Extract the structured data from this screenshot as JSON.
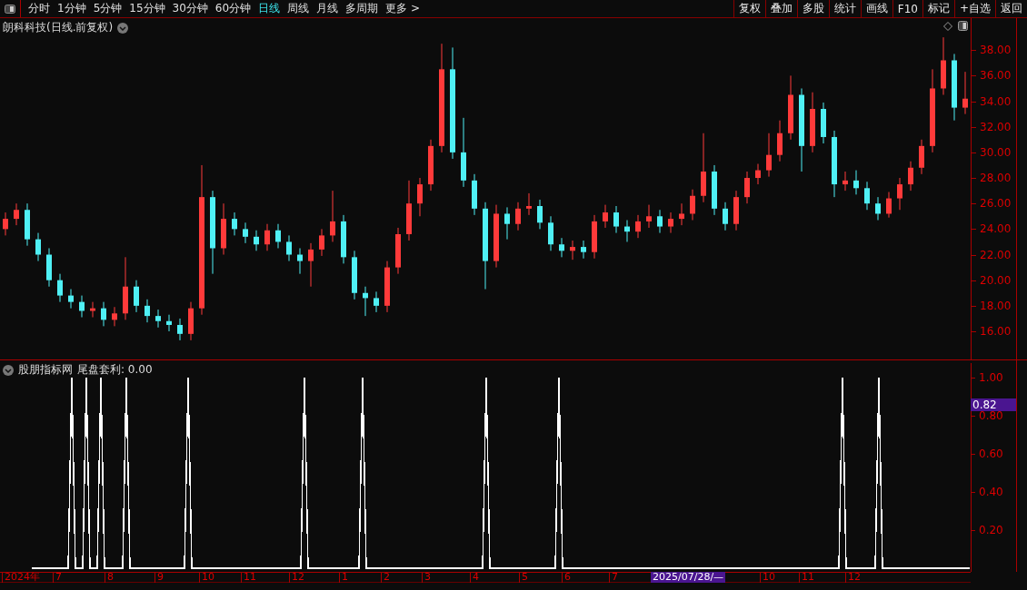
{
  "toolbar": {
    "periods": [
      {
        "label": "分时",
        "selected": false
      },
      {
        "label": "1分钟",
        "selected": false
      },
      {
        "label": "5分钟",
        "selected": false
      },
      {
        "label": "15分钟",
        "selected": false
      },
      {
        "label": "30分钟",
        "selected": false
      },
      {
        "label": "60分钟",
        "selected": false
      },
      {
        "label": "日线",
        "selected": true
      },
      {
        "label": "周线",
        "selected": false
      },
      {
        "label": "月线",
        "selected": false
      },
      {
        "label": "多周期",
        "selected": false
      },
      {
        "label": "更多 >",
        "selected": false
      }
    ],
    "actions": [
      "复权",
      "叠加",
      "多股",
      "统计",
      "画线",
      "F10",
      "标记",
      "+自选",
      "返回"
    ]
  },
  "main_chart": {
    "title": "朗科科技(日线.前复权)",
    "chart_data": {
      "type": "candlestick",
      "ylim": [
        13.8,
        40.5
      ],
      "yticks": [
        {
          "value": 38,
          "label": "38.00"
        },
        {
          "value": 36,
          "label": "36.00"
        },
        {
          "value": 34,
          "label": "34.00"
        },
        {
          "value": 32,
          "label": "32.00"
        },
        {
          "value": 30,
          "label": "30.00"
        },
        {
          "value": 28,
          "label": "28.00"
        },
        {
          "value": 26,
          "label": "26.00"
        },
        {
          "value": 24,
          "label": "24.00"
        },
        {
          "value": 22,
          "label": "22.00"
        },
        {
          "value": 20,
          "label": "20.00"
        },
        {
          "value": 18,
          "label": "18.00"
        },
        {
          "value": 16,
          "label": "16.00"
        }
      ],
      "categories": [
        null,
        null,
        null,
        null,
        null,
        null,
        null,
        null,
        null,
        null,
        null,
        null,
        null,
        null,
        null,
        null,
        null,
        null,
        null,
        null,
        null,
        null,
        null,
        null,
        null,
        null,
        null,
        null,
        null,
        null,
        null,
        null,
        null,
        null,
        null,
        null,
        null,
        null,
        null,
        null,
        null,
        null,
        null,
        null,
        null,
        null,
        null,
        null,
        null,
        null,
        null,
        null,
        null,
        null,
        null,
        null,
        null,
        null,
        null,
        null,
        null,
        null,
        null,
        null,
        null,
        null,
        null,
        null,
        null,
        null,
        null,
        null,
        null,
        null,
        null,
        null,
        null,
        null,
        null,
        null,
        null,
        null,
        null,
        null,
        null,
        null,
        null,
        null,
        null
      ],
      "ohlc": [
        [
          24.0,
          25.3,
          23.5,
          24.8
        ],
        [
          24.8,
          26.0,
          24.3,
          25.5
        ],
        [
          25.5,
          26.0,
          22.7,
          23.2
        ],
        [
          23.2,
          23.7,
          21.5,
          22.0
        ],
        [
          22.0,
          22.5,
          19.5,
          20.0
        ],
        [
          20.0,
          20.5,
          18.3,
          18.8
        ],
        [
          18.8,
          19.3,
          17.8,
          18.3
        ],
        [
          18.3,
          18.8,
          17.1,
          17.6
        ],
        [
          17.6,
          18.3,
          17.1,
          17.8
        ],
        [
          17.8,
          18.3,
          16.4,
          16.9
        ],
        [
          16.9,
          17.9,
          16.4,
          17.4
        ],
        [
          17.4,
          21.8,
          16.9,
          19.5
        ],
        [
          19.5,
          20.0,
          17.5,
          18.0
        ],
        [
          18.0,
          18.5,
          16.7,
          17.2
        ],
        [
          17.2,
          17.7,
          16.3,
          16.8
        ],
        [
          16.8,
          17.3,
          16.0,
          16.5
        ],
        [
          16.5,
          17.0,
          15.3,
          15.8
        ],
        [
          15.8,
          18.3,
          15.3,
          17.8
        ],
        [
          17.8,
          29.0,
          17.3,
          26.5
        ],
        [
          26.5,
          27.0,
          20.5,
          22.5
        ],
        [
          22.5,
          26.0,
          22.0,
          24.8
        ],
        [
          24.8,
          25.3,
          23.5,
          24.0
        ],
        [
          24.0,
          24.5,
          22.9,
          23.4
        ],
        [
          23.4,
          23.9,
          22.3,
          22.8
        ],
        [
          22.8,
          24.4,
          22.3,
          23.9
        ],
        [
          23.9,
          24.4,
          22.5,
          23.0
        ],
        [
          23.0,
          23.5,
          21.5,
          22.0
        ],
        [
          22.0,
          22.5,
          20.5,
          21.5
        ],
        [
          21.5,
          22.9,
          19.5,
          22.4
        ],
        [
          22.4,
          24.0,
          21.9,
          23.5
        ],
        [
          23.5,
          27.0,
          23.0,
          24.6
        ],
        [
          24.6,
          25.1,
          21.3,
          21.8
        ],
        [
          21.8,
          22.3,
          18.5,
          19.0
        ],
        [
          19.0,
          19.5,
          17.2,
          18.6
        ],
        [
          18.6,
          19.1,
          17.5,
          18.0
        ],
        [
          18.0,
          21.5,
          17.5,
          21.0
        ],
        [
          21.0,
          24.1,
          20.5,
          23.6
        ],
        [
          23.6,
          27.8,
          23.1,
          26.0
        ],
        [
          26.0,
          28.0,
          25.0,
          27.5
        ],
        [
          27.5,
          31.0,
          27.0,
          30.5
        ],
        [
          30.5,
          38.5,
          30.0,
          36.5
        ],
        [
          36.5,
          38.2,
          29.5,
          30.0
        ],
        [
          30.0,
          32.7,
          27.3,
          27.8
        ],
        [
          27.8,
          28.3,
          25.1,
          25.6
        ],
        [
          25.6,
          26.1,
          19.3,
          21.5
        ],
        [
          21.5,
          25.9,
          21.0,
          25.2
        ],
        [
          25.2,
          25.7,
          23.2,
          24.4
        ],
        [
          24.4,
          26.1,
          23.9,
          25.6
        ],
        [
          25.6,
          26.8,
          25.1,
          25.8
        ],
        [
          25.8,
          26.3,
          24.0,
          24.5
        ],
        [
          24.5,
          25.0,
          22.3,
          22.8
        ],
        [
          22.8,
          23.3,
          21.8,
          22.3
        ],
        [
          22.3,
          23.1,
          21.6,
          22.6
        ],
        [
          22.6,
          23.1,
          21.7,
          22.2
        ],
        [
          22.2,
          25.1,
          21.7,
          24.6
        ],
        [
          24.6,
          25.9,
          24.1,
          25.3
        ],
        [
          25.3,
          25.8,
          23.7,
          24.2
        ],
        [
          24.2,
          24.7,
          23.0,
          23.8
        ],
        [
          23.8,
          25.1,
          23.3,
          24.6
        ],
        [
          24.6,
          25.9,
          24.1,
          25.0
        ],
        [
          25.0,
          25.5,
          23.7,
          24.2
        ],
        [
          24.2,
          25.3,
          23.7,
          24.8
        ],
        [
          24.8,
          26.0,
          24.3,
          25.2
        ],
        [
          25.2,
          27.1,
          24.7,
          26.6
        ],
        [
          26.6,
          31.5,
          26.1,
          28.5
        ],
        [
          28.5,
          29.0,
          25.1,
          25.6
        ],
        [
          25.6,
          26.1,
          23.9,
          24.4
        ],
        [
          24.4,
          27.0,
          23.9,
          26.5
        ],
        [
          26.5,
          28.5,
          26.0,
          28.0
        ],
        [
          28.0,
          29.1,
          27.5,
          28.6
        ],
        [
          28.6,
          31.5,
          28.1,
          29.8
        ],
        [
          29.8,
          32.5,
          29.3,
          31.5
        ],
        [
          31.5,
          36.0,
          31.0,
          34.5
        ],
        [
          34.5,
          35.0,
          28.5,
          30.5
        ],
        [
          30.5,
          34.7,
          30.0,
          33.4
        ],
        [
          33.4,
          33.9,
          30.7,
          31.2
        ],
        [
          31.2,
          31.7,
          26.5,
          27.5
        ],
        [
          27.5,
          28.5,
          27.0,
          27.8
        ],
        [
          27.8,
          28.6,
          26.7,
          27.2
        ],
        [
          27.2,
          27.7,
          25.5,
          26.0
        ],
        [
          26.0,
          26.5,
          24.7,
          25.2
        ],
        [
          25.2,
          26.9,
          24.9,
          26.4
        ],
        [
          26.4,
          28.0,
          25.5,
          27.5
        ],
        [
          27.5,
          29.3,
          27.0,
          28.8
        ],
        [
          28.8,
          31.0,
          28.3,
          30.5
        ],
        [
          30.5,
          36.5,
          30.0,
          35.0
        ],
        [
          35.0,
          39.0,
          34.5,
          37.2
        ],
        [
          37.2,
          37.7,
          32.5,
          33.5
        ],
        [
          33.5,
          36.3,
          33.0,
          34.2
        ]
      ]
    }
  },
  "indicator": {
    "source": "股朋指标网",
    "reading": ": 0.00",
    "cursor_value": "0.82",
    "chart_data": {
      "type": "line",
      "ylim": [
        -0.0167,
        1.079
      ],
      "yticks": [
        {
          "value": 0.2,
          "label": "0.20"
        },
        {
          "value": 0.4,
          "label": "0.40"
        },
        {
          "value": 0.6,
          "label": "0.60"
        },
        {
          "value": 0.8,
          "label": "0.80"
        },
        {
          "value": 1.0,
          "label": "1.00"
        }
      ],
      "categories": [
        null,
        null,
        null,
        null,
        null,
        null,
        null,
        null,
        null,
        null,
        null,
        null,
        null,
        null,
        null,
        null,
        null,
        null,
        null,
        null,
        null,
        null,
        null,
        null,
        null,
        null,
        null,
        null,
        null,
        null,
        null,
        null,
        null,
        null,
        null,
        null,
        null,
        null,
        null,
        null,
        null,
        null,
        null,
        null,
        null,
        null,
        null,
        null,
        null,
        null,
        null,
        null,
        null,
        null,
        null,
        null,
        null,
        null,
        null,
        null,
        null,
        null,
        null,
        null,
        null,
        null,
        null,
        null,
        null,
        null,
        null,
        null,
        null,
        null,
        null,
        null,
        null,
        null,
        null,
        null,
        null,
        null,
        null,
        null,
        null,
        null,
        null,
        null,
        null,
        null,
        null,
        null,
        null,
        null,
        null,
        null,
        null,
        null,
        null,
        null,
        null,
        null,
        null,
        null,
        null,
        null,
        null,
        null,
        null,
        null,
        null,
        null,
        null,
        null,
        null,
        null,
        null,
        null,
        null,
        null,
        null,
        null,
        null,
        null,
        null,
        null,
        null,
        null,
        null,
        null,
        null,
        null,
        null,
        null,
        null,
        null,
        null,
        null,
        null,
        null,
        null,
        null,
        null,
        null,
        null,
        null,
        null,
        null,
        null,
        null,
        null,
        null,
        null,
        null,
        null,
        null,
        null,
        null,
        null,
        null,
        null,
        null,
        null,
        null,
        null,
        null,
        null,
        null,
        null,
        null,
        null,
        null,
        null,
        null,
        null,
        null,
        null,
        null,
        null,
        null,
        null,
        null,
        null,
        null,
        null,
        null,
        null,
        null,
        null,
        null,
        null,
        null,
        null,
        null,
        null,
        null,
        null,
        null,
        null,
        null,
        null,
        null,
        null,
        null,
        null,
        null,
        null,
        null,
        null,
        null,
        null,
        null,
        null,
        null,
        null,
        null,
        null,
        null,
        null,
        null,
        null,
        null,
        null,
        null,
        null,
        null,
        null,
        null,
        null,
        null,
        null,
        null,
        null,
        null,
        null,
        null,
        null,
        null,
        null,
        null,
        null,
        null,
        null,
        null,
        null,
        null,
        null,
        null,
        null,
        null,
        null,
        null,
        null,
        null,
        null,
        null,
        null,
        null,
        null
      ],
      "series": [
        {
          "name": "尾盘套利",
          "color": "#ffffff",
          "values": [
            0,
            0,
            0,
            0,
            0,
            0,
            0,
            0,
            0,
            0,
            0,
            1,
            0,
            0,
            0,
            1,
            0,
            0,
            0,
            1,
            0,
            0,
            0,
            0,
            0,
            0,
            1,
            0,
            0,
            0,
            0,
            0,
            0,
            0,
            0,
            0,
            0,
            0,
            0,
            0,
            0,
            0,
            0,
            1,
            0,
            0,
            0,
            0,
            0,
            0,
            0,
            0,
            0,
            0,
            0,
            0,
            0,
            0,
            0,
            0,
            0,
            0,
            0,
            0,
            0,
            0,
            0,
            0,
            0,
            0,
            0,
            0,
            0,
            0,
            0,
            1,
            0,
            0,
            0,
            0,
            0,
            0,
            0,
            0,
            0,
            0,
            0,
            0,
            0,
            0,
            0,
            1,
            0,
            0,
            0,
            0,
            0,
            0,
            0,
            0,
            0,
            0,
            0,
            0,
            0,
            0,
            0,
            0,
            0,
            0,
            0,
            0,
            0,
            0,
            0,
            0,
            0,
            0,
            0,
            0,
            0,
            0,
            0,
            0,
            0,
            1,
            0,
            0,
            0,
            0,
            0,
            0,
            0,
            0,
            0,
            0,
            0,
            0,
            0,
            0,
            0,
            0,
            0,
            0,
            0,
            1,
            0,
            0,
            0,
            0,
            0,
            0,
            0,
            0,
            0,
            0,
            0,
            0,
            0,
            0,
            0,
            0,
            0,
            0,
            0,
            0,
            0,
            0,
            0,
            0,
            0,
            0,
            0,
            0,
            0,
            0,
            0,
            0,
            0,
            0,
            0,
            0,
            0,
            0,
            0,
            0,
            0,
            0,
            0,
            0,
            0,
            0,
            0,
            0,
            0,
            0,
            0,
            0,
            0,
            0,
            0,
            0,
            0,
            0,
            0,
            0,
            0,
            0,
            0,
            0,
            0,
            0,
            0,
            0,
            0,
            0,
            0,
            0,
            0,
            0,
            0,
            0,
            0,
            1,
            0,
            0,
            0,
            0,
            0,
            0,
            0,
            0,
            0,
            1,
            0,
            0,
            0,
            0,
            0,
            0,
            0,
            0,
            0,
            0,
            0,
            0,
            0,
            0,
            0,
            0,
            0,
            0,
            0,
            0,
            0,
            0,
            0,
            0,
            0
          ]
        }
      ]
    }
  },
  "date_axis": {
    "labels": [
      "2024年",
      "7",
      "8",
      "9",
      "10",
      "11",
      "12",
      "1",
      "2",
      "3",
      "4",
      "5",
      "6",
      "7",
      "10",
      "11",
      "12"
    ],
    "cursor_date": "2025/07/28/—"
  }
}
